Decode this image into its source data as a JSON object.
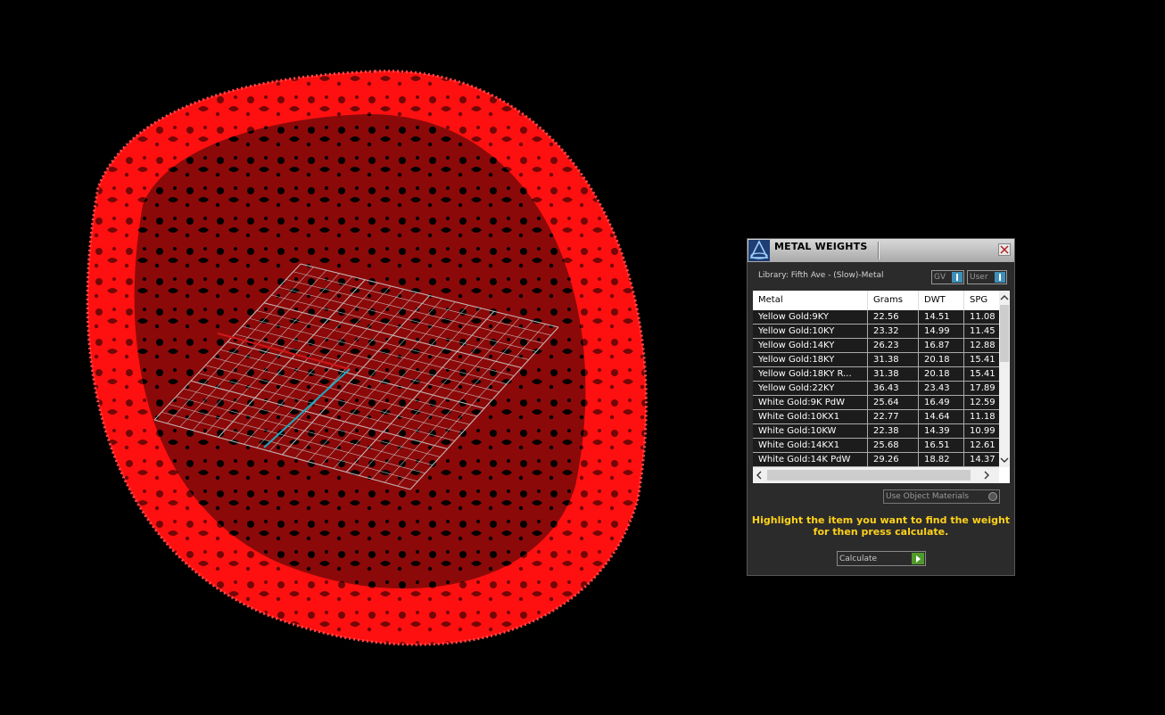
{
  "panel": {
    "title": "METAL WEIGHTS",
    "library_label": "Library: Fifth Ave - (Slow)-Metal",
    "gv_toggle_label": "GV",
    "user_toggle_label": "User",
    "columns": [
      "Metal",
      "Grams",
      "DWT",
      "SPG"
    ],
    "rows": [
      [
        "Yellow Gold:9KY",
        "22.56",
        "14.51",
        "11.08"
      ],
      [
        "Yellow Gold:10KY",
        "23.32",
        "14.99",
        "11.45"
      ],
      [
        "Yellow Gold:14KY",
        "26.23",
        "16.87",
        "12.88"
      ],
      [
        "Yellow Gold:18KY",
        "31.38",
        "20.18",
        "15.41"
      ],
      [
        "Yellow Gold:18KY R...",
        "31.38",
        "20.18",
        "15.41"
      ],
      [
        "Yellow Gold:22KY",
        "36.43",
        "23.43",
        "17.89"
      ],
      [
        "White Gold:9K PdW",
        "25.64",
        "16.49",
        "12.59"
      ],
      [
        "White Gold:10KX1",
        "22.77",
        "14.64",
        "11.18"
      ],
      [
        "White Gold:10KW",
        "22.38",
        "14.39",
        "10.99"
      ],
      [
        "White Gold:14KX1",
        "25.68",
        "16.51",
        "12.61"
      ],
      [
        "White Gold:14K PdW",
        "29.26",
        "18.82",
        "14.37"
      ]
    ],
    "use_object_materials_label": "Use Object Materials",
    "instructions": "Highlight the item you want to find the weight for then press calculate.",
    "calculate_label": "Calculate"
  },
  "colors": {
    "ring": "#ff1010",
    "grid": "#c8c8c8",
    "x_axis": "#d01818",
    "y_axis": "#20a8c0",
    "instructions_text": "#ffd21a",
    "accent_green": "#4f9a2a",
    "accent_blue": "#3d8fb8"
  },
  "icons": [
    "app-logo-icon",
    "close-icon",
    "scroll-up-icon",
    "scroll-down-icon",
    "scroll-left-icon",
    "scroll-right-icon",
    "play-arrow-icon"
  ]
}
